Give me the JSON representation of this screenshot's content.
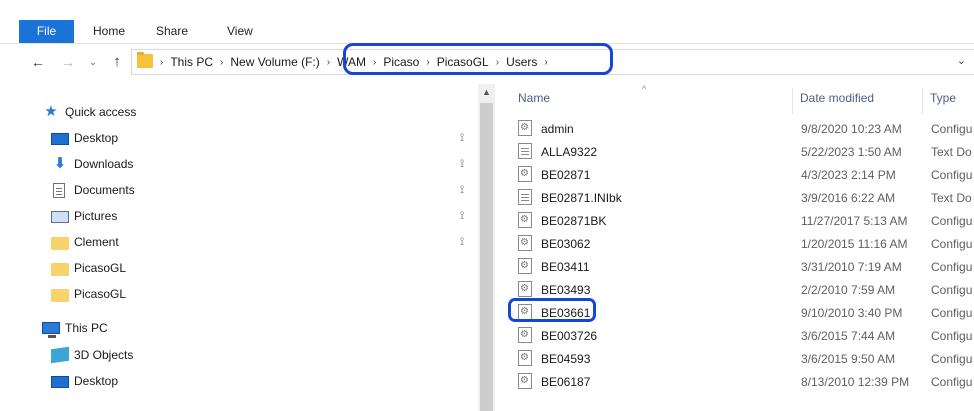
{
  "ribbon": {
    "tabs": [
      "File",
      "Home",
      "Share",
      "View"
    ]
  },
  "nav": {
    "back": "←",
    "forward": "→",
    "recent": "⌄",
    "up": "↑",
    "crumb_sep": "›",
    "breadcrumb": [
      "This PC",
      "New Volume (F:)",
      "WAM",
      "Picaso",
      "PicasoGL",
      "Users"
    ],
    "dropdown": "⌄"
  },
  "sidebar": {
    "items": [
      {
        "label": "Quick access",
        "icon": "star-icon",
        "pinned": false
      },
      {
        "label": "Desktop",
        "icon": "desktop-icon",
        "pinned": true
      },
      {
        "label": "Downloads",
        "icon": "download-icon",
        "pinned": true
      },
      {
        "label": "Documents",
        "icon": "documents-icon",
        "pinned": true
      },
      {
        "label": "Pictures",
        "icon": "pictures-icon",
        "pinned": true
      },
      {
        "label": "Clement",
        "icon": "folder-icon",
        "pinned": true
      },
      {
        "label": "PicasoGL",
        "icon": "folder-icon",
        "pinned": false
      },
      {
        "label": "PicasoGL",
        "icon": "folder-icon",
        "pinned": false
      },
      {
        "label": "This PC",
        "icon": "this-pc-icon",
        "pinned": false
      },
      {
        "label": "3D Objects",
        "icon": "3d-objects-icon",
        "pinned": false
      },
      {
        "label": "Desktop",
        "icon": "desktop-icon",
        "pinned": false
      }
    ],
    "pin_glyph": "📌"
  },
  "filelist": {
    "columns": {
      "name": "Name",
      "date": "Date modified",
      "type": "Type"
    },
    "sort_indicator": "^",
    "rows": [
      {
        "name": "admin",
        "date": "9/8/2020 10:23 AM",
        "type": "Configu",
        "icon": "config-file-icon"
      },
      {
        "name": "ALLA9322",
        "date": "5/22/2023 1:50 AM",
        "type": "Text Do",
        "icon": "text-file-icon"
      },
      {
        "name": "BE02871",
        "date": "4/3/2023 2:14 PM",
        "type": "Configu",
        "icon": "config-file-icon"
      },
      {
        "name": "BE02871.INIbk",
        "date": "3/9/2016 6:22 AM",
        "type": "Text Do",
        "icon": "text-file-icon"
      },
      {
        "name": "BE02871BK",
        "date": "11/27/2017 5:13 AM",
        "type": "Configu",
        "icon": "config-file-icon"
      },
      {
        "name": "BE03062",
        "date": "1/20/2015 11:16 AM",
        "type": "Configu",
        "icon": "config-file-icon"
      },
      {
        "name": "BE03411",
        "date": "3/31/2010 7:19 AM",
        "type": "Configu",
        "icon": "config-file-icon"
      },
      {
        "name": "BE03493",
        "date": "2/2/2010 7:59 AM",
        "type": "Configu",
        "icon": "config-file-icon"
      },
      {
        "name": "BE03661",
        "date": "9/10/2010 3:40 PM",
        "type": "Configu",
        "icon": "config-file-icon"
      },
      {
        "name": "BE003726",
        "date": "3/6/2015 7:44 AM",
        "type": "Configu",
        "icon": "config-file-icon"
      },
      {
        "name": "BE04593",
        "date": "3/6/2015 9:50 AM",
        "type": "Configu",
        "icon": "config-file-icon"
      },
      {
        "name": "BE06187",
        "date": "8/13/2010 12:39 PM",
        "type": "Configu",
        "icon": "config-file-icon"
      }
    ]
  },
  "colors": {
    "file_tab": "#1a73d9",
    "annotation": "#1546d6",
    "column_header": "#4d6082"
  }
}
